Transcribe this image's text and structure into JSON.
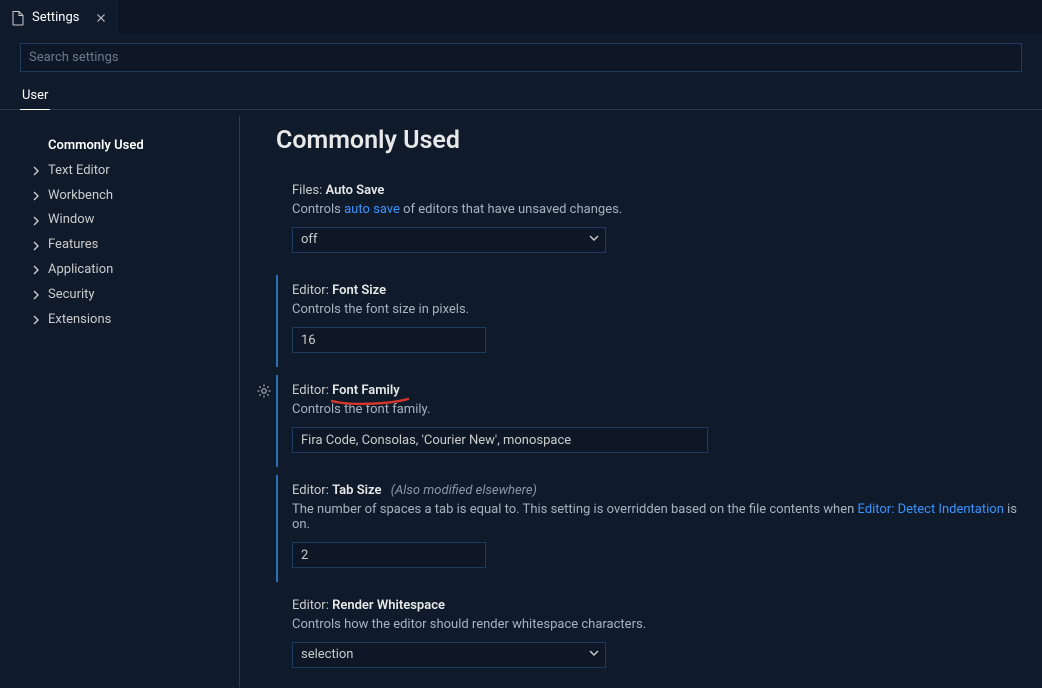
{
  "tab": {
    "label": "Settings"
  },
  "search": {
    "placeholder": "Search settings"
  },
  "scope": {
    "user": "User"
  },
  "sidebar": {
    "items": [
      {
        "label": "Commonly Used",
        "active": true
      },
      {
        "label": "Text Editor"
      },
      {
        "label": "Workbench"
      },
      {
        "label": "Window"
      },
      {
        "label": "Features"
      },
      {
        "label": "Application"
      },
      {
        "label": "Security"
      },
      {
        "label": "Extensions"
      }
    ]
  },
  "content": {
    "title": "Commonly Used",
    "autoSave": {
      "scope": "Files:",
      "name": "Auto Save",
      "descPre": "Controls ",
      "descLink": "auto save",
      "descPost": " of editors that have unsaved changes.",
      "value": "off"
    },
    "fontSize": {
      "scope": "Editor:",
      "name": "Font Size",
      "desc": "Controls the font size in pixels.",
      "value": "16"
    },
    "fontFamily": {
      "scope": "Editor:",
      "name": "Font Family",
      "desc": "Controls the font family.",
      "value": "Fira Code, Consolas, 'Courier New', monospace"
    },
    "tabSize": {
      "scope": "Editor:",
      "name": "Tab Size",
      "also": "(Also modified elsewhere)",
      "descPre": "The number of spaces a tab is equal to. This setting is overridden based on the file contents when ",
      "descLink": "Editor: Detect Indentation",
      "descPost": " is on.",
      "value": "2"
    },
    "renderWhitespace": {
      "scope": "Editor:",
      "name": "Render Whitespace",
      "desc": "Controls how the editor should render whitespace characters.",
      "value": "selection"
    }
  }
}
